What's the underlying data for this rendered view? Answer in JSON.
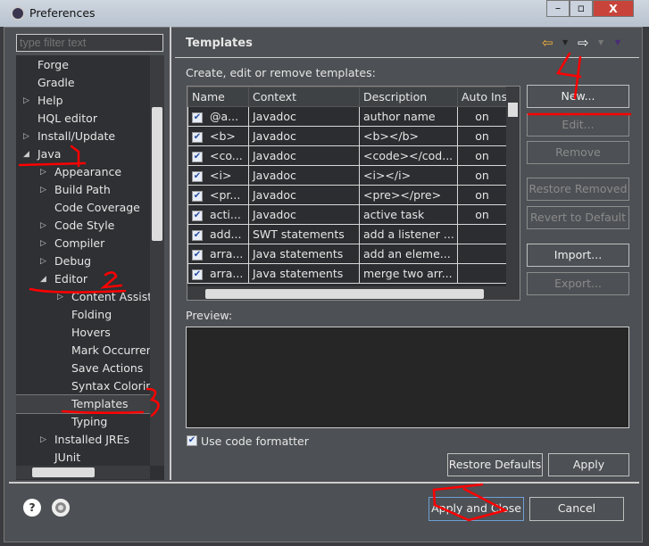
{
  "window": {
    "title": "Preferences"
  },
  "filter": {
    "placeholder": "type filter text"
  },
  "tree": [
    {
      "label": "Forge",
      "level": 0,
      "arrow": ""
    },
    {
      "label": "Gradle",
      "level": 0,
      "arrow": ""
    },
    {
      "label": "Help",
      "level": 0,
      "arrow": "▷"
    },
    {
      "label": "HQL editor",
      "level": 0,
      "arrow": ""
    },
    {
      "label": "Install/Update",
      "level": 0,
      "arrow": "▷"
    },
    {
      "label": "Java",
      "level": 0,
      "arrow": "◢"
    },
    {
      "label": "Appearance",
      "level": 1,
      "arrow": "▷"
    },
    {
      "label": "Build Path",
      "level": 1,
      "arrow": "▷"
    },
    {
      "label": "Code Coverage",
      "level": 1,
      "arrow": ""
    },
    {
      "label": "Code Style",
      "level": 1,
      "arrow": "▷"
    },
    {
      "label": "Compiler",
      "level": 1,
      "arrow": "▷"
    },
    {
      "label": "Debug",
      "level": 1,
      "arrow": "▷"
    },
    {
      "label": "Editor",
      "level": 1,
      "arrow": "◢"
    },
    {
      "label": "Content Assist",
      "level": 2,
      "arrow": "▷"
    },
    {
      "label": "Folding",
      "level": 2,
      "arrow": ""
    },
    {
      "label": "Hovers",
      "level": 2,
      "arrow": ""
    },
    {
      "label": "Mark Occurren",
      "level": 2,
      "arrow": ""
    },
    {
      "label": "Save Actions",
      "level": 2,
      "arrow": ""
    },
    {
      "label": "Syntax Coloring",
      "level": 2,
      "arrow": ""
    },
    {
      "label": "Templates",
      "level": 2,
      "arrow": "",
      "selected": true
    },
    {
      "label": "Typing",
      "level": 2,
      "arrow": ""
    },
    {
      "label": "Installed JREs",
      "level": 1,
      "arrow": "▷"
    },
    {
      "label": "JUnit",
      "level": 1,
      "arrow": ""
    }
  ],
  "page": {
    "title": "Templates",
    "description": "Create, edit or remove templates:",
    "preview_label": "Preview:",
    "use_formatter": "Use code formatter",
    "use_formatter_checked": true
  },
  "table": {
    "columns": [
      "Name",
      "Context",
      "Description",
      "Auto Ins"
    ],
    "rows": [
      {
        "name": "@a...",
        "context": "Javadoc",
        "description": "author name",
        "auto": "on",
        "checked": true
      },
      {
        "name": "<b>",
        "context": "Javadoc",
        "description": "<b></b>",
        "auto": "on",
        "checked": true
      },
      {
        "name": "<co...",
        "context": "Javadoc",
        "description": "<code></cod...",
        "auto": "on",
        "checked": true
      },
      {
        "name": "<i>",
        "context": "Javadoc",
        "description": "<i></i>",
        "auto": "on",
        "checked": true
      },
      {
        "name": "<pr...",
        "context": "Javadoc",
        "description": "<pre></pre>",
        "auto": "on",
        "checked": true
      },
      {
        "name": "acti...",
        "context": "Javadoc",
        "description": "active task",
        "auto": "on",
        "checked": true
      },
      {
        "name": "add...",
        "context": "SWT statements",
        "description": "add a listener ...",
        "auto": "",
        "checked": true
      },
      {
        "name": "arra...",
        "context": "Java statements",
        "description": "add an eleme...",
        "auto": "",
        "checked": true
      },
      {
        "name": "arra...",
        "context": "Java statements",
        "description": "merge two arr...",
        "auto": "",
        "checked": true
      }
    ]
  },
  "side_buttons": {
    "new": "New...",
    "edit": "Edit...",
    "remove": "Remove",
    "restore_removed": "Restore Removed",
    "revert": "Revert to Default",
    "import": "Import...",
    "export": "Export..."
  },
  "bottom": {
    "restore_defaults": "Restore Defaults",
    "apply": "Apply",
    "apply_close": "Apply and Close",
    "cancel": "Cancel"
  },
  "annotations": [
    "1",
    "2",
    "3",
    "4"
  ],
  "colors": {
    "annotation": "#ff0000",
    "background": "#4d5054"
  }
}
